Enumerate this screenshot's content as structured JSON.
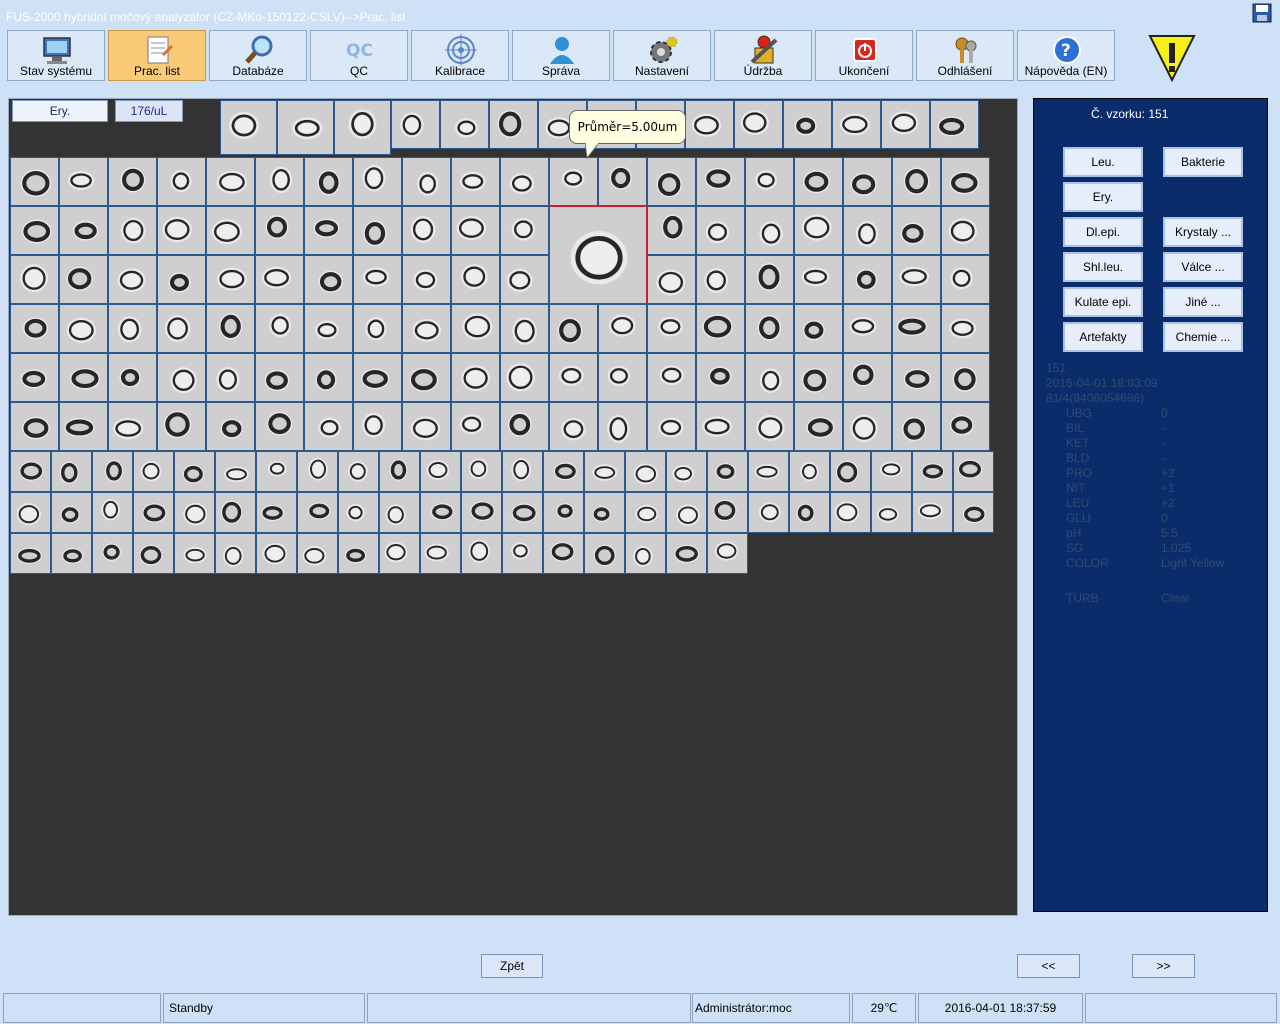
{
  "window": {
    "title": "FUS-2000 hybridní močový analyzátor (CZ-MKo-150122-CSLV)-->Prac. list"
  },
  "toolbar": [
    {
      "label": "Stav systému",
      "icon": "monitor-icon"
    },
    {
      "label": "Prac. list",
      "icon": "worklist-icon",
      "active": true
    },
    {
      "label": "Databáze",
      "icon": "magnifier-icon"
    },
    {
      "label": "QC",
      "icon": "qc-icon"
    },
    {
      "label": "Kalibrace",
      "icon": "target-icon"
    },
    {
      "label": "Správa",
      "icon": "user-icon"
    },
    {
      "label": "Nastavení",
      "icon": "gear-icon"
    },
    {
      "label": "Údržba",
      "icon": "maintenance-icon"
    },
    {
      "label": "Ukončení",
      "icon": "power-icon"
    },
    {
      "label": "Odhlášení",
      "icon": "keys-icon"
    },
    {
      "label": "Nápověda (EN)",
      "icon": "help-icon"
    }
  ],
  "grid": {
    "category": "Ery.",
    "count": "176/uL",
    "tooltip": "Průměr=5.00um"
  },
  "panel": {
    "sample_label": "Č. vzorku: 151",
    "categories": [
      {
        "label": "Leu."
      },
      {
        "label": "Bakterie"
      },
      {
        "label": "Ery."
      },
      {
        "label": "Dl.epi."
      },
      {
        "label": "Krystaly ..."
      },
      {
        "label": "Shl.leu."
      },
      {
        "label": "Válce ..."
      },
      {
        "label": "Kulate epi."
      },
      {
        "label": "Jiné ..."
      },
      {
        "label": "Artefakty"
      },
      {
        "label": "Chemie ..."
      }
    ],
    "sample_id": "151",
    "datetime": "2016-04-01 18:03:09",
    "barcode": "81/4(8406054686)",
    "chemistry": [
      {
        "k": "UBG",
        "v": "0"
      },
      {
        "k": "BIL",
        "v": "-"
      },
      {
        "k": "KET",
        "v": "-"
      },
      {
        "k": "BLD",
        "v": "-"
      },
      {
        "k": "PRO",
        "v": "+2"
      },
      {
        "k": "NIT",
        "v": "+1"
      },
      {
        "k": "LEU",
        "v": "+2"
      },
      {
        "k": "GLU",
        "v": "0"
      },
      {
        "k": "pH",
        "v": "5.5"
      },
      {
        "k": "SG",
        "v": "1.025"
      },
      {
        "k": "COLOR",
        "v": "Light Yellow"
      },
      {
        "k": "TURB",
        "v": "Clear"
      }
    ]
  },
  "nav": {
    "back": "Zpět",
    "prev": "<<",
    "next": ">>"
  },
  "status": {
    "empty1": "",
    "state": "Standby",
    "empty2": "",
    "user": "Administrátor:moc",
    "temperature": "29℃",
    "clock": "2016-04-01 18:37:59"
  },
  "colors": {
    "panel": "#0a2c6b",
    "active_tab": "#fbca77",
    "grid_bg": "#333333"
  }
}
